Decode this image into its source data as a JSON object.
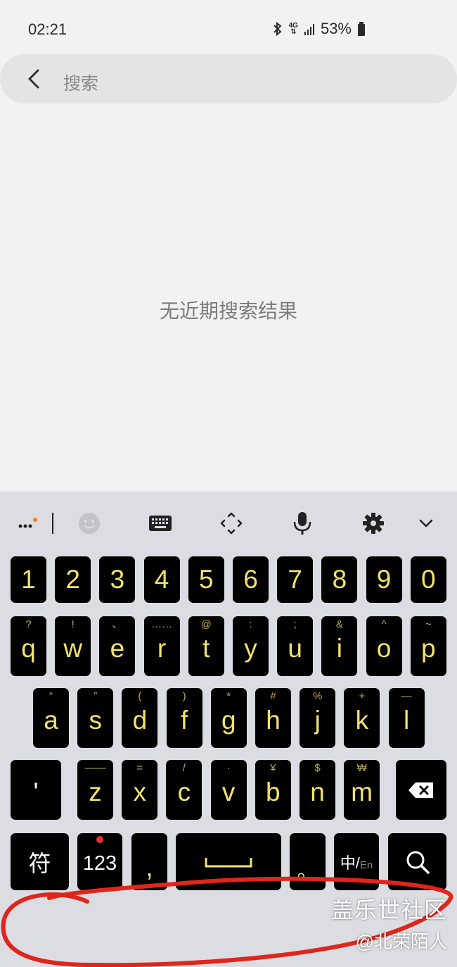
{
  "status_bar": {
    "time": "02:21",
    "network_top": "4G",
    "battery_percent": "53%"
  },
  "search": {
    "placeholder": "搜索"
  },
  "empty_message": "无近期搜索结果",
  "keyboard": {
    "number_row": [
      "1",
      "2",
      "3",
      "4",
      "5",
      "6",
      "7",
      "8",
      "9",
      "0"
    ],
    "row1": [
      {
        "main": "q",
        "sub": "?"
      },
      {
        "main": "w",
        "sub": "!"
      },
      {
        "main": "e",
        "sub": "、"
      },
      {
        "main": "r",
        "sub": "……"
      },
      {
        "main": "t",
        "sub": "@"
      },
      {
        "main": "y",
        "sub": ":"
      },
      {
        "main": "u",
        "sub": ";"
      },
      {
        "main": "i",
        "sub": "&"
      },
      {
        "main": "o",
        "sub": "^"
      },
      {
        "main": "p",
        "sub": "~"
      }
    ],
    "row2": [
      {
        "main": "a",
        "sub": "“"
      },
      {
        "main": "s",
        "sub": "”"
      },
      {
        "main": "d",
        "sub": "("
      },
      {
        "main": "f",
        "sub": ")"
      },
      {
        "main": "g",
        "sub": "*"
      },
      {
        "main": "h",
        "sub": "#"
      },
      {
        "main": "j",
        "sub": "%"
      },
      {
        "main": "k",
        "sub": "+"
      },
      {
        "main": "l",
        "sub": "—"
      }
    ],
    "row3_left": "'",
    "row3": [
      {
        "main": "z",
        "sub": "——"
      },
      {
        "main": "x",
        "sub": "="
      },
      {
        "main": "c",
        "sub": "/"
      },
      {
        "main": "v",
        "sub": "·"
      },
      {
        "main": "b",
        "sub": "¥"
      },
      {
        "main": "n",
        "sub": "$"
      },
      {
        "main": "m",
        "sub": "₩"
      }
    ],
    "symbols_key": "符",
    "numbers_key": "123",
    "comma_key": ",",
    "period_key": "。",
    "lang_key_main": "中/",
    "lang_key_sub": "En"
  },
  "watermark": {
    "line1": "盖乐世社区",
    "line2": "@北荣陌人"
  },
  "colors": {
    "key_text": "#f3e36a",
    "key_bg": "#000000",
    "scribble": "#e0251b"
  }
}
